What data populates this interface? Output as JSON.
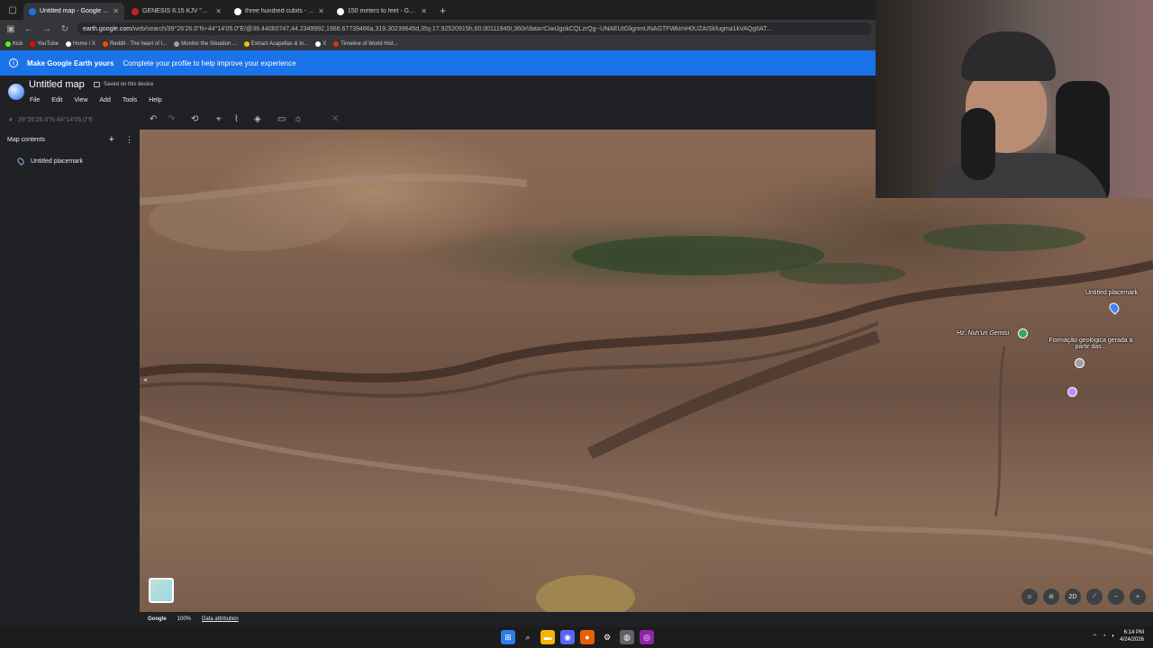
{
  "browser": {
    "tabs": [
      {
        "title": "Untitled map - Google Earth",
        "color": "#1a73e8",
        "active": true
      },
      {
        "title": "GENESIS 6:15 KJV \"And this is t",
        "color": "#c5221f",
        "active": false
      },
      {
        "title": "three hundred cubits - Google",
        "color": "#ffffff",
        "active": false
      },
      {
        "title": "150 meters to feet - Google Se",
        "color": "#ffffff",
        "active": false
      }
    ],
    "url_host": "earth.google.com",
    "url_path": "/web/search/39°26'26.0\"N+44°14'05.0\"E/@39.44060747,44.2349992,1966.67739466a,319.30239645d,35y,17.92520915h,60.00111945t,360r/data=CiwiJgokCQLzrQg--UNAEUtGlignmUNAGTFWkimH0UZAISkfugma1kVAQgIIAT...",
    "bookmarks": [
      {
        "label": "Kick",
        "color": "#53fc18"
      },
      {
        "label": "YouTube",
        "color": "#ff0000"
      },
      {
        "label": "Home / X",
        "color": "#ffffff"
      },
      {
        "label": "Reddit - The heart of t...",
        "color": "#ff4500"
      },
      {
        "label": "Monitor the Situation ...",
        "color": "#9aa0a6"
      },
      {
        "label": "Extract Acapellas & In...",
        "color": "#fbbc04"
      },
      {
        "label": "X",
        "color": "#ffffff"
      },
      {
        "label": "Timeline of World Hist...",
        "color": "#d93025"
      }
    ]
  },
  "banner": {
    "title": "Make Google Earth yours",
    "message": "Complete your profile to help improve your experience"
  },
  "app": {
    "title": "Untitled map",
    "saved": "Saved on this device",
    "menu": [
      "File",
      "Edit",
      "View",
      "Add",
      "Tools",
      "Help"
    ],
    "search_placeholder": "39°26'26.0\"N 44°14'05.0\"E"
  },
  "sidebar": {
    "heading": "Map contents",
    "items": [
      {
        "label": "Untitled placemark"
      }
    ]
  },
  "map": {
    "labels": {
      "placemark": "Untitled placemark",
      "noah": "Hz. Nuh'un Gemisi",
      "formation": "Formação geológica gerada a partir das..."
    },
    "bottom": {
      "brand": "Google",
      "zoom": "100%",
      "attribution": "Data attribution"
    },
    "controls": {
      "mode": "2D"
    }
  },
  "taskbar": {
    "time": "6:14 PM",
    "date": "4/24/2026"
  }
}
